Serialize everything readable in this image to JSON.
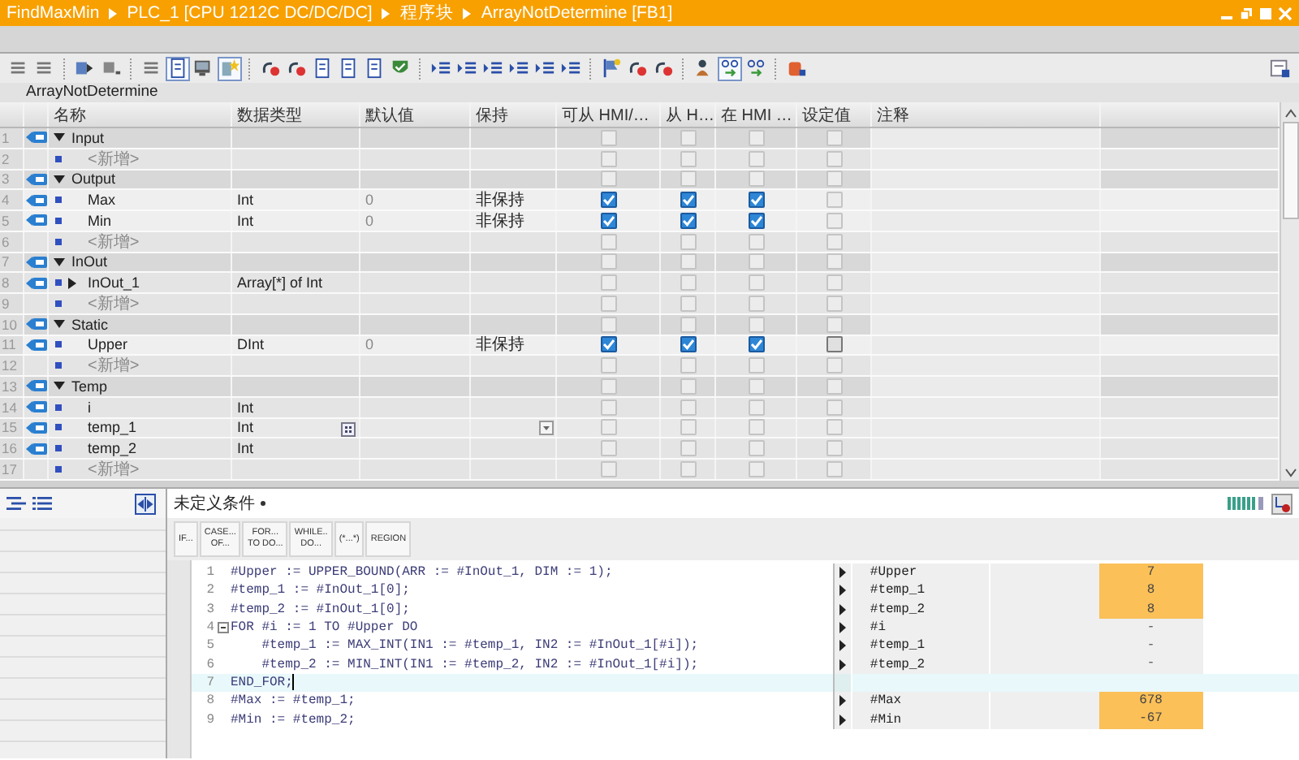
{
  "title_bar": {
    "breadcrumb": [
      "FindMaxMin",
      "PLC_1 [CPU 1212C DC/DC/DC]",
      "程序块",
      "ArrayNotDetermine [FB1]"
    ]
  },
  "toolbar": [
    {
      "kind": "lines",
      "on": false
    },
    {
      "kind": "lines",
      "on": false
    },
    {
      "kind": "sep"
    },
    {
      "kind": "arrow",
      "on": false
    },
    {
      "kind": "square",
      "on": false
    },
    {
      "kind": "sep"
    },
    {
      "kind": "lines",
      "on": false
    },
    {
      "kind": "doc",
      "on": true
    },
    {
      "kind": "monitor",
      "on": false
    },
    {
      "kind": "star",
      "on": true
    },
    {
      "kind": "sep"
    },
    {
      "kind": "undo",
      "on": false
    },
    {
      "kind": "undo",
      "on": false
    },
    {
      "kind": "doc",
      "on": false
    },
    {
      "kind": "doc",
      "on": false
    },
    {
      "kind": "doc",
      "on": false
    },
    {
      "kind": "shield",
      "on": false
    },
    {
      "kind": "sep"
    },
    {
      "kind": "indent",
      "on": false
    },
    {
      "kind": "indent",
      "on": false
    },
    {
      "kind": "indent",
      "on": false
    },
    {
      "kind": "indent",
      "on": false
    },
    {
      "kind": "indent",
      "on": false
    },
    {
      "kind": "indent",
      "on": false
    },
    {
      "kind": "sep"
    },
    {
      "kind": "flag",
      "on": false
    },
    {
      "kind": "undo",
      "on": false
    },
    {
      "kind": "undo",
      "on": false
    },
    {
      "kind": "sep"
    },
    {
      "kind": "person",
      "on": false
    },
    {
      "kind": "glasses",
      "on": true
    },
    {
      "kind": "glasses",
      "on": false
    },
    {
      "kind": "sep"
    },
    {
      "kind": "jar",
      "on": false
    }
  ],
  "block_name": "ArrayNotDetermine",
  "table": {
    "columns": [
      "名称",
      "数据类型",
      "默认值",
      "保持",
      "可从 HMI/…",
      "从 H…",
      "在 HMI …",
      "设定值",
      "注释"
    ],
    "rows": [
      {
        "no": "1",
        "kind": "section",
        "name": "Input",
        "expanded": true,
        "checks": [
          false,
          false,
          false,
          false
        ],
        "setpoint_enabled": false,
        "selected": false
      },
      {
        "no": "2",
        "kind": "add",
        "name": "<新增>",
        "checks": [
          false,
          false,
          false,
          false
        ],
        "setpoint_enabled": false,
        "selected": false
      },
      {
        "no": "3",
        "kind": "section",
        "name": "Output",
        "expanded": true,
        "checks": [
          false,
          false,
          false,
          false
        ],
        "setpoint_enabled": false,
        "selected": false
      },
      {
        "no": "4",
        "kind": "var",
        "name": "Max",
        "data_type": "Int",
        "default": "0",
        "retain": "非保持",
        "checks": [
          true,
          true,
          true,
          false
        ],
        "setpoint_enabled": false,
        "selected": false
      },
      {
        "no": "5",
        "kind": "var",
        "name": "Min",
        "data_type": "Int",
        "default": "0",
        "retain": "非保持",
        "checks": [
          true,
          true,
          true,
          false
        ],
        "setpoint_enabled": false,
        "selected": false
      },
      {
        "no": "6",
        "kind": "add",
        "name": "<新增>",
        "checks": [
          false,
          false,
          false,
          false
        ],
        "setpoint_enabled": false,
        "selected": false
      },
      {
        "no": "7",
        "kind": "section",
        "name": "InOut",
        "expanded": true,
        "checks": [
          false,
          false,
          false,
          false
        ],
        "setpoint_enabled": false,
        "selected": false
      },
      {
        "no": "8",
        "kind": "var",
        "name": "InOut_1",
        "expanded": false,
        "data_type": "Array[*] of Int",
        "checks": [
          false,
          false,
          false,
          false
        ],
        "setpoint_enabled": false,
        "selected": false
      },
      {
        "no": "9",
        "kind": "add",
        "name": "<新增>",
        "checks": [
          false,
          false,
          false,
          false
        ],
        "setpoint_enabled": false,
        "selected": false
      },
      {
        "no": "10",
        "kind": "section",
        "name": "Static",
        "expanded": true,
        "checks": [
          false,
          false,
          false,
          false
        ],
        "setpoint_enabled": false,
        "selected": false
      },
      {
        "no": "11",
        "kind": "var",
        "name": "Upper",
        "data_type": "DInt",
        "default": "0",
        "retain": "非保持",
        "checks": [
          true,
          true,
          true,
          false
        ],
        "setpoint_enabled": true,
        "selected": false
      },
      {
        "no": "12",
        "kind": "add",
        "name": "<新增>",
        "checks": [
          false,
          false,
          false,
          false
        ],
        "setpoint_enabled": false,
        "selected": false
      },
      {
        "no": "13",
        "kind": "section",
        "name": "Temp",
        "expanded": true,
        "checks": [
          false,
          false,
          false,
          false
        ],
        "setpoint_enabled": false,
        "selected": false
      },
      {
        "no": "14",
        "kind": "var",
        "name": "i",
        "data_type": "Int",
        "checks": [
          false,
          false,
          false,
          false
        ],
        "setpoint_enabled": false,
        "selected": false
      },
      {
        "no": "15",
        "kind": "var",
        "name": "temp_1",
        "data_type": "Int",
        "checks": [
          false,
          false,
          false,
          false
        ],
        "setpoint_enabled": false,
        "selected": true
      },
      {
        "no": "16",
        "kind": "var",
        "name": "temp_2",
        "data_type": "Int",
        "checks": [
          false,
          false,
          false,
          false
        ],
        "setpoint_enabled": false,
        "selected": false
      },
      {
        "no": "17",
        "kind": "add",
        "name": "<新增>",
        "checks": [
          false,
          false,
          false,
          false
        ],
        "setpoint_enabled": false,
        "selected": false
      }
    ]
  },
  "editor": {
    "condition": "未定义条件",
    "templates": [
      {
        "lines": [
          "IF..."
        ]
      },
      {
        "lines": [
          "CASE...",
          "OF..."
        ]
      },
      {
        "lines": [
          "FOR...",
          "TO DO..."
        ]
      },
      {
        "lines": [
          "WHILE..",
          "DO..."
        ]
      },
      {
        "lines": [
          "(*...*)"
        ]
      },
      {
        "lines": [
          "REGION"
        ]
      }
    ],
    "code": [
      {
        "no": "1",
        "text": "#Upper := UPPER_BOUND(ARR := #InOut_1, DIM := 1);",
        "current": false,
        "watch": [
          {
            "name": "#Upper",
            "value": "7",
            "highlighted": true
          }
        ]
      },
      {
        "no": "2",
        "text": "#temp_1 := #InOut_1[0];",
        "current": false,
        "watch": [
          {
            "name": "#temp_1",
            "value": "8",
            "highlighted": true
          }
        ]
      },
      {
        "no": "3",
        "text": "#temp_2 := #InOut_1[0];",
        "current": false,
        "watch": [
          {
            "name": "#temp_2",
            "value": "8",
            "highlighted": true
          }
        ]
      },
      {
        "no": "4",
        "text": "FOR #i := 1 TO #Upper DO",
        "fold": true,
        "current": false,
        "watch": [
          {
            "name": "#i",
            "value": "-",
            "highlighted": false
          }
        ]
      },
      {
        "no": "5",
        "text": "    #temp_1 := MAX_INT(IN1 := #temp_1, IN2 := #InOut_1[#i]);",
        "current": false,
        "watch": [
          {
            "name": "#temp_1",
            "value": "-",
            "highlighted": false
          }
        ]
      },
      {
        "no": "6",
        "text": "    #temp_2 := MIN_INT(IN1 := #temp_2, IN2 := #InOut_1[#i]);",
        "current": false,
        "watch": [
          {
            "name": "#temp_2",
            "value": "-",
            "highlighted": false
          }
        ]
      },
      {
        "no": "7",
        "text": "END_FOR;",
        "current": true
      },
      {
        "no": "8",
        "text": "#Max := #temp_1;",
        "current": false,
        "watch": [
          {
            "name": "#Max",
            "value": "678",
            "highlighted": true
          }
        ]
      },
      {
        "no": "9",
        "text": "#Min := #temp_2;",
        "current": false,
        "watch": [
          {
            "name": "#Min",
            "value": "-67",
            "highlighted": true
          }
        ]
      }
    ]
  }
}
